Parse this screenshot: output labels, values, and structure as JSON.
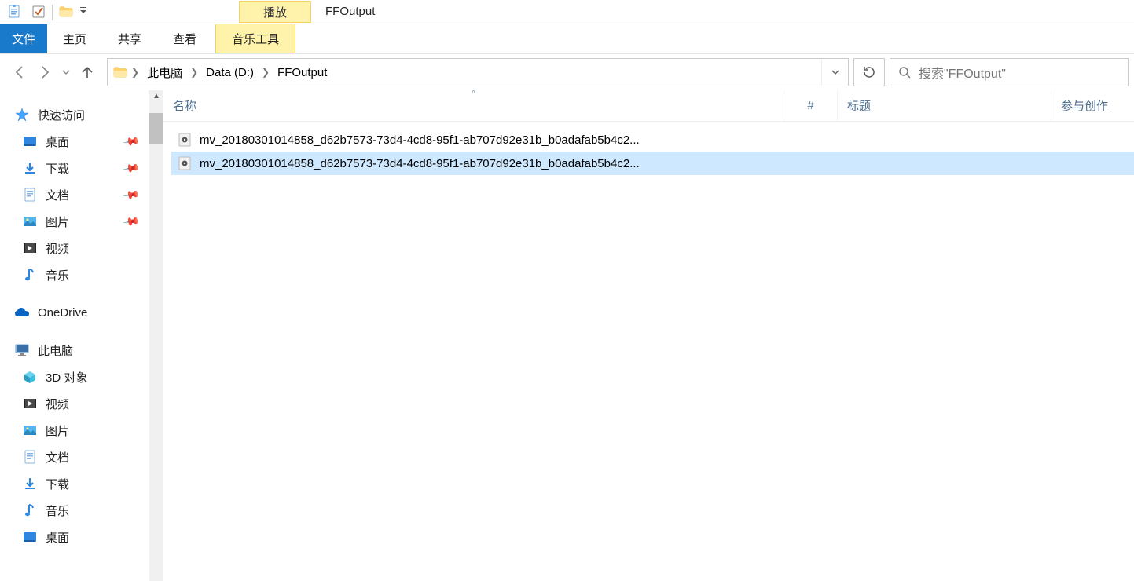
{
  "titlebar": {
    "context_label": "播放",
    "window_title": "FFOutput"
  },
  "ribbon": {
    "file": "文件",
    "home": "主页",
    "share": "共享",
    "view": "查看",
    "music_tools": "音乐工具"
  },
  "breadcrumb": [
    {
      "label": "此电脑"
    },
    {
      "label": "Data (D:)"
    },
    {
      "label": "FFOutput"
    }
  ],
  "search": {
    "placeholder": "搜索\"FFOutput\""
  },
  "columns": {
    "name": "名称",
    "hash": "#",
    "title": "标题",
    "participating": "参与创作"
  },
  "files": [
    {
      "name": "mv_20180301014858_d62b7573-73d4-4cd8-95f1-ab707d92e31b_b0adafab5b4c2...",
      "selected": false
    },
    {
      "name": "mv_20180301014858_d62b7573-73d4-4cd8-95f1-ab707d92e31b_b0adafab5b4c2...",
      "selected": true
    }
  ],
  "sidebar": {
    "quick_access": "快速访问",
    "quick_items": [
      {
        "label": "桌面",
        "icon": "desktop",
        "pinned": true
      },
      {
        "label": "下载",
        "icon": "download",
        "pinned": true
      },
      {
        "label": "文档",
        "icon": "documents",
        "pinned": true
      },
      {
        "label": "图片",
        "icon": "pictures",
        "pinned": true
      },
      {
        "label": "视频",
        "icon": "videos",
        "pinned": false
      },
      {
        "label": "音乐",
        "icon": "music",
        "pinned": false
      }
    ],
    "onedrive": "OneDrive",
    "this_pc": "此电脑",
    "pc_items": [
      {
        "label": "3D 对象",
        "icon": "3d"
      },
      {
        "label": "视频",
        "icon": "videos"
      },
      {
        "label": "图片",
        "icon": "pictures"
      },
      {
        "label": "文档",
        "icon": "documents"
      },
      {
        "label": "下载",
        "icon": "download"
      },
      {
        "label": "音乐",
        "icon": "music"
      },
      {
        "label": "桌面",
        "icon": "desktop"
      }
    ]
  }
}
